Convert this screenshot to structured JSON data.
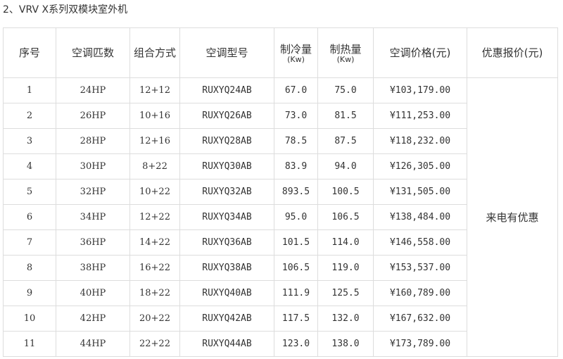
{
  "heading": "2、VRV X系列双模块室外机",
  "table": {
    "headers": {
      "index": "序号",
      "capacity": "空调匹数",
      "combo": "组合方式",
      "model": "空调型号",
      "cooling": "制冷量",
      "cooling_unit": "(Kw)",
      "heating": "制热量",
      "heating_unit": "(Kw)",
      "price": "空调价格(元)",
      "offer": "优惠报价(元)"
    },
    "offer_text": "来电有优惠",
    "rows": [
      {
        "index": "1",
        "capacity": "24HP",
        "combo": "12+12",
        "model": "RUXYQ24AB",
        "cooling": "67.0",
        "heating": "75.0",
        "price": "¥103,179.00"
      },
      {
        "index": "2",
        "capacity": "26HP",
        "combo": "10+16",
        "model": "RUXYQ26AB",
        "cooling": "73.0",
        "heating": "81.5",
        "price": "¥111,253.00"
      },
      {
        "index": "3",
        "capacity": "28HP",
        "combo": "12+16",
        "model": "RUXYQ28AB",
        "cooling": "78.5",
        "heating": "87.5",
        "price": "¥118,232.00"
      },
      {
        "index": "4",
        "capacity": "30HP",
        "combo": "8+22",
        "model": "RUXYQ30AB",
        "cooling": "83.9",
        "heating": "94.0",
        "price": "¥126,305.00"
      },
      {
        "index": "5",
        "capacity": "32HP",
        "combo": "10+22",
        "model": "RUXYQ32AB",
        "cooling": "893.5",
        "heating": "100.5",
        "price": "¥131,505.00"
      },
      {
        "index": "6",
        "capacity": "34HP",
        "combo": "12+22",
        "model": "RUXYQ34AB",
        "cooling": "95.0",
        "heating": "106.5",
        "price": "¥138,484.00"
      },
      {
        "index": "7",
        "capacity": "36HP",
        "combo": "14+22",
        "model": "RUXYQ36AB",
        "cooling": "101.5",
        "heating": "114.0",
        "price": "¥146,558.00"
      },
      {
        "index": "8",
        "capacity": "38HP",
        "combo": "16+22",
        "model": "RUXYQ38AB",
        "cooling": "106.5",
        "heating": "119.0",
        "price": "¥153,537.00"
      },
      {
        "index": "9",
        "capacity": "40HP",
        "combo": "18+22",
        "model": "RUXYQ40AB",
        "cooling": "111.9",
        "heating": "125.5",
        "price": "¥160,789.00"
      },
      {
        "index": "10",
        "capacity": "42HP",
        "combo": "20+22",
        "model": "RUXYQ42AB",
        "cooling": "117.5",
        "heating": "132.0",
        "price": "¥167,632.00"
      },
      {
        "index": "11",
        "capacity": "44HP",
        "combo": "22+22",
        "model": "RUXYQ44AB",
        "cooling": "123.0",
        "heating": "138.0",
        "price": "¥173,789.00"
      }
    ]
  }
}
